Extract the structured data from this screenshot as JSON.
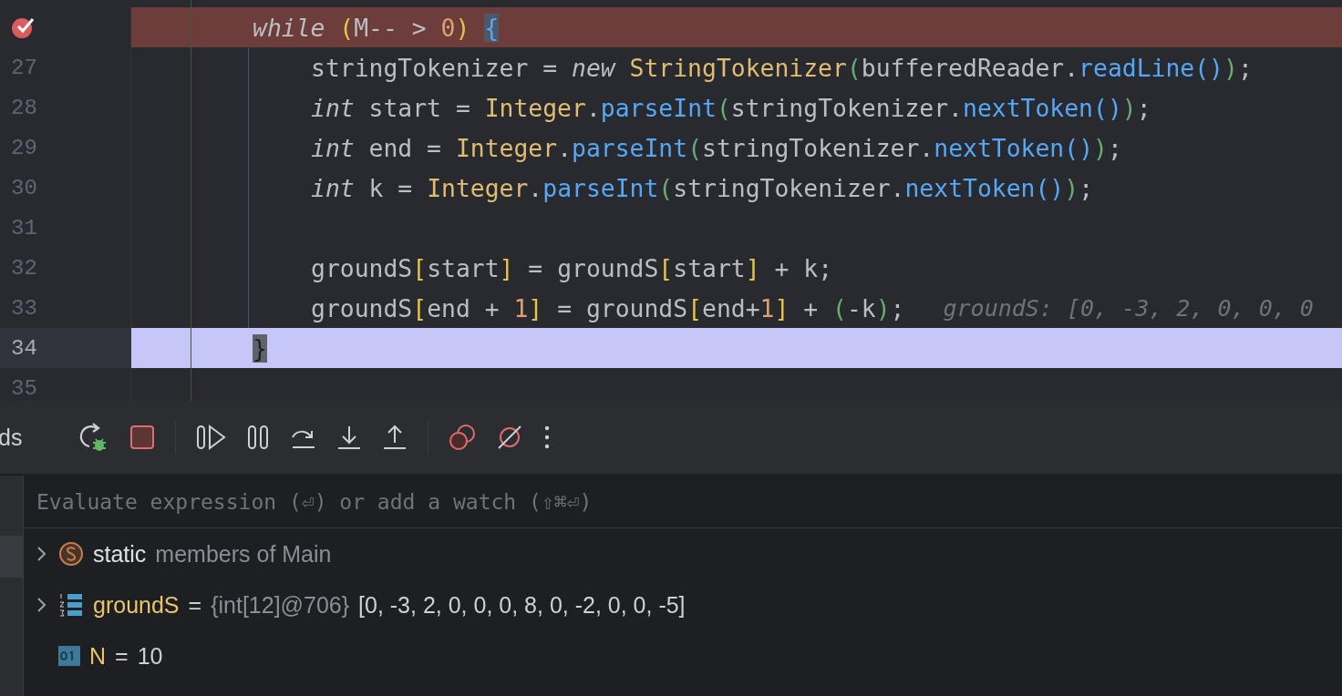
{
  "editor": {
    "lines": [
      {
        "breakpoint": true,
        "current": false,
        "tokens": [
          {
            "kind": "kw",
            "s": "while"
          },
          {
            "kind": "p1",
            "s": " ("
          },
          {
            "kind": "t",
            "s": "M-- > "
          },
          {
            "kind": "num",
            "s": "0"
          },
          {
            "kind": "p1",
            "s": ") "
          },
          {
            "kind": "match3",
            "s": "{"
          }
        ],
        "children": [
          {
            "number": "27",
            "breakpoint": false,
            "current": false,
            "tokens": [
              {
                "kind": "t",
                "s": "stringTokenizer = "
              },
              {
                "kind": "kw",
                "s": "new "
              },
              {
                "kind": "cls",
                "s": "StringTokenizer"
              },
              {
                "kind": "p2",
                "s": "("
              },
              {
                "kind": "t",
                "s": "bufferedReader."
              },
              {
                "kind": "fn",
                "s": "readLine"
              },
              {
                "kind": "p3",
                "s": "()"
              },
              {
                "kind": "p2",
                "s": ")"
              },
              {
                "kind": "t",
                "s": ";"
              }
            ]
          },
          {
            "number": "28",
            "breakpoint": false,
            "current": false,
            "tokens": [
              {
                "kind": "kw",
                "s": "int"
              },
              {
                "kind": "t",
                "s": " start = "
              },
              {
                "kind": "cls",
                "s": "Integer"
              },
              {
                "kind": "t",
                "s": "."
              },
              {
                "kind": "fn",
                "s": "parseInt"
              },
              {
                "kind": "p2",
                "s": "("
              },
              {
                "kind": "t",
                "s": "stringTokenizer."
              },
              {
                "kind": "fn",
                "s": "nextToken"
              },
              {
                "kind": "p3",
                "s": "()"
              },
              {
                "kind": "p2",
                "s": ")"
              },
              {
                "kind": "t",
                "s": ";"
              }
            ]
          },
          {
            "number": "29",
            "breakpoint": false,
            "current": false,
            "tokens": [
              {
                "kind": "kw",
                "s": "int"
              },
              {
                "kind": "t",
                "s": " end = "
              },
              {
                "kind": "cls",
                "s": "Integer"
              },
              {
                "kind": "t",
                "s": "."
              },
              {
                "kind": "fn",
                "s": "parseInt"
              },
              {
                "kind": "p2",
                "s": "("
              },
              {
                "kind": "t",
                "s": "stringTokenizer."
              },
              {
                "kind": "fn",
                "s": "nextToken"
              },
              {
                "kind": "p3",
                "s": "()"
              },
              {
                "kind": "p2",
                "s": ")"
              },
              {
                "kind": "t",
                "s": ";"
              }
            ]
          },
          {
            "number": "30",
            "breakpoint": false,
            "current": false,
            "tokens": [
              {
                "kind": "kw",
                "s": "int"
              },
              {
                "kind": "t",
                "s": " k = "
              },
              {
                "kind": "cls",
                "s": "Integer"
              },
              {
                "kind": "t",
                "s": "."
              },
              {
                "kind": "fn",
                "s": "parseInt"
              },
              {
                "kind": "p2",
                "s": "("
              },
              {
                "kind": "t",
                "s": "stringTokenizer."
              },
              {
                "kind": "fn",
                "s": "nextToken"
              },
              {
                "kind": "p3",
                "s": "()"
              },
              {
                "kind": "p2",
                "s": ")"
              },
              {
                "kind": "t",
                "s": ";"
              }
            ]
          },
          {
            "number": "31",
            "breakpoint": false,
            "current": false
          },
          {
            "number": "32",
            "breakpoint": false,
            "current": false,
            "tokens": [
              {
                "kind": "t",
                "s": "groundS"
              },
              {
                "kind": "p1",
                "s": "["
              },
              {
                "kind": "t",
                "s": "start"
              },
              {
                "kind": "p1",
                "s": "]"
              },
              {
                "kind": "t",
                "s": " = groundS"
              },
              {
                "kind": "p1",
                "s": "["
              },
              {
                "kind": "t",
                "s": "start"
              },
              {
                "kind": "p1",
                "s": "]"
              },
              {
                "kind": "t",
                "s": " + k;"
              }
            ]
          },
          {
            "number": "33",
            "breakpoint": false,
            "current": false,
            "tokens": [
              {
                "kind": "t",
                "s": "groundS"
              },
              {
                "kind": "p1",
                "s": "["
              },
              {
                "kind": "t",
                "s": "end + "
              },
              {
                "kind": "num",
                "s": "1"
              },
              {
                "kind": "p1",
                "s": "]"
              },
              {
                "kind": "t",
                "s": " = groundS"
              },
              {
                "kind": "p1",
                "s": "["
              },
              {
                "kind": "t",
                "s": "end+"
              },
              {
                "kind": "num",
                "s": "1"
              },
              {
                "kind": "p1",
                "s": "]"
              },
              {
                "kind": "t",
                "s": " + "
              },
              {
                "kind": "p2",
                "s": "("
              },
              {
                "kind": "t",
                "s": "-k"
              },
              {
                "kind": "p2",
                "s": ")"
              },
              {
                "kind": "t",
                "s": ";"
              },
              {
                "kind": "hint",
                "s": "groundS: [0, -3, 2, 0, 0, 0"
              }
            ]
          }
        ]
      },
      {
        "number": "34",
        "breakpoint": false,
        "current": true,
        "tokens": [
          {
            "kind": "match",
            "s": "}"
          }
        ]
      },
      {
        "number": "35",
        "breakpoint": false,
        "current": false
      }
    ]
  },
  "debugger": {
    "tab_label": "ds",
    "eval_field": {
      "placeholder": "Evaluate expression (⏎) or add a watch (⇧⌘⏎)"
    },
    "variables": [
      {
        "kind": "static",
        "expandable": true,
        "name": "static",
        "detail": "members of Main"
      },
      {
        "kind": "array",
        "expandable": true,
        "name": "groundS",
        "equals": "=",
        "type": "{int[12]@706}",
        "value": "[0, -3, 2, 0, 0, 0, 8, 0, -2, 0, 0, -5]"
      },
      {
        "kind": "primitive",
        "expandable": false,
        "name": "N",
        "equals": "=",
        "value": "10"
      }
    ]
  }
}
